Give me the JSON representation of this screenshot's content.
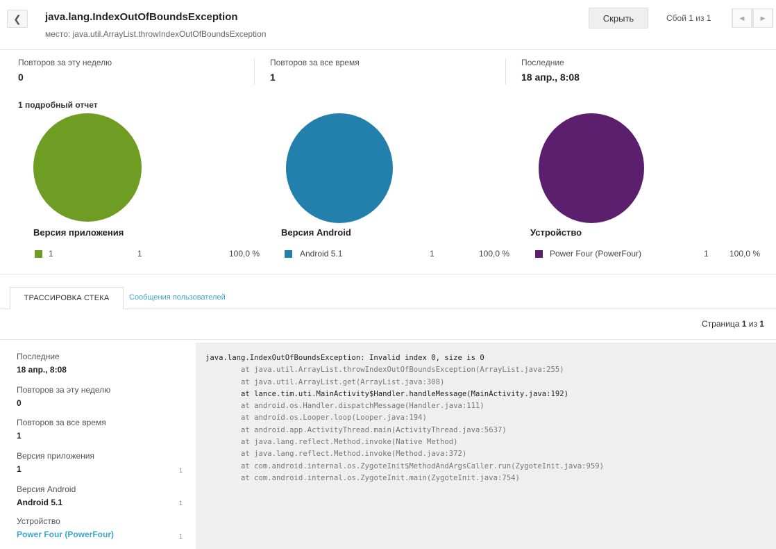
{
  "header": {
    "back_icon": "chevron-left-icon",
    "title": "java.lang.IndexOutOfBoundsException",
    "subtitle": "место: java.util.ArrayList.throwIndexOutOfBoundsException",
    "hide_label": "Скрыть",
    "crash_count": "Сбой 1 из 1",
    "prev_icon": "chevron-left-icon",
    "next_icon": "chevron-right-icon"
  },
  "stats": [
    {
      "label": "Повторов за эту неделю",
      "value": "0"
    },
    {
      "label": "Повторов за все время",
      "value": "1"
    },
    {
      "label": "Последние",
      "value": "18 апр., 8:08"
    }
  ],
  "reports_count": "1 подробный отчет",
  "pies": [
    {
      "title": "Версия приложения",
      "color": "#6f9c23",
      "legend": {
        "name": "1",
        "count": "1",
        "percent": "100,0 %"
      }
    },
    {
      "title": "Версия Android",
      "color": "#2380ac",
      "legend": {
        "name": "Android 5.1",
        "count": "1",
        "percent": "100,0 %"
      }
    },
    {
      "title": "Устройство",
      "color": "#5c1f6e",
      "legend": {
        "name": "Power Four (PowerFour)",
        "count": "1",
        "percent": "100,0 %"
      }
    }
  ],
  "tabs": {
    "active": "ТРАССИРОВКА СТЕКА",
    "inactive": "Сообщения пользователей"
  },
  "pagination": {
    "prefix": "Страница ",
    "current": "1",
    "middle": " из ",
    "total": "1"
  },
  "details": {
    "last_label": "Последние",
    "last_value": "18 апр., 8:08",
    "week_label": "Повторов за эту неделю",
    "week_value": "0",
    "all_label": "Повторов за все время",
    "all_value": "1",
    "app_version_label": "Версия приложения",
    "app_version_value": "1",
    "app_version_count": "1",
    "android_label": "Версия Android",
    "android_value": "Android 5.1",
    "android_count": "1",
    "device_label": "Устройство",
    "device_value": "Power Four (PowerFour)",
    "device_count": "1"
  },
  "stack_trace": [
    "java.lang.IndexOutOfBoundsException: Invalid index 0, size is 0",
    "        at java.util.ArrayList.throwIndexOutOfBoundsException(ArrayList.java:255)",
    "        at java.util.ArrayList.get(ArrayList.java:308)",
    "        at lance.tim.uti.MainActivity$Handler.handleMessage(MainActivity.java:192)",
    "        at android.os.Handler.dispatchMessage(Handler.java:111)",
    "        at android.os.Looper.loop(Looper.java:194)",
    "        at android.app.ActivityThread.main(ActivityThread.java:5637)",
    "        at java.lang.reflect.Method.invoke(Native Method)",
    "        at java.lang.reflect.Method.invoke(Method.java:372)",
    "        at com.android.internal.os.ZygoteInit$MethodAndArgsCaller.run(ZygoteInit.java:959)",
    "        at com.android.internal.os.ZygoteInit.main(ZygoteInit.java:754)"
  ]
}
